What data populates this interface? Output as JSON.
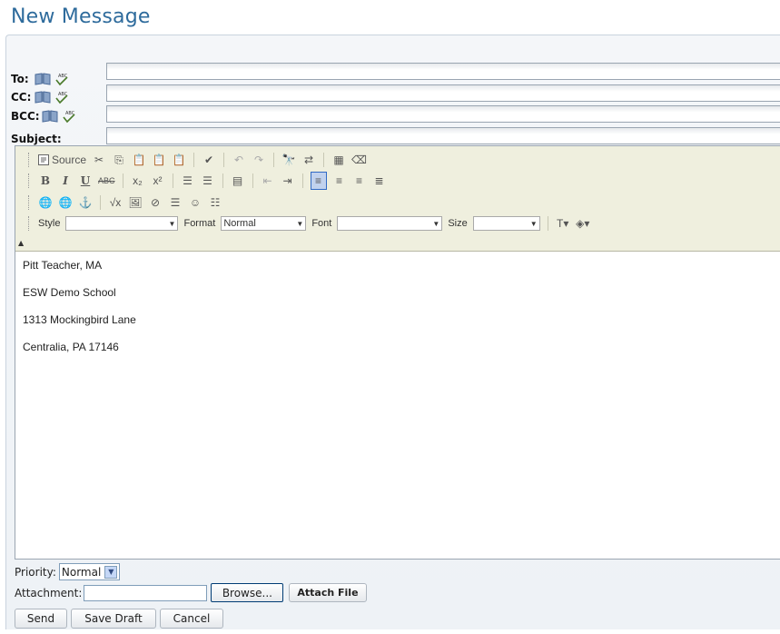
{
  "page": {
    "title": "New Message"
  },
  "recipients": [
    {
      "label": "To:",
      "name": "to"
    },
    {
      "label": "CC:",
      "name": "cc"
    },
    {
      "label": "BCC:",
      "name": "bcc"
    },
    {
      "label": "Subject:",
      "name": "subject"
    }
  ],
  "toolbar": {
    "source_label": "Source",
    "style_label": "Style",
    "format_label": "Format",
    "format_value": "Normal",
    "font_label": "Font",
    "size_label": "Size"
  },
  "body_lines": [
    "Pitt Teacher, MA",
    "ESW Demo School",
    "1313 Mockingbird Lane",
    "Centralia, PA 17146"
  ],
  "footer": {
    "priority_label": "Priority:",
    "priority_value": "Normal",
    "attachment_label": "Attachment:",
    "browse_label": "Browse...",
    "attach_label": "Attach File",
    "send_label": "Send",
    "save_draft_label": "Save Draft",
    "cancel_label": "Cancel"
  }
}
